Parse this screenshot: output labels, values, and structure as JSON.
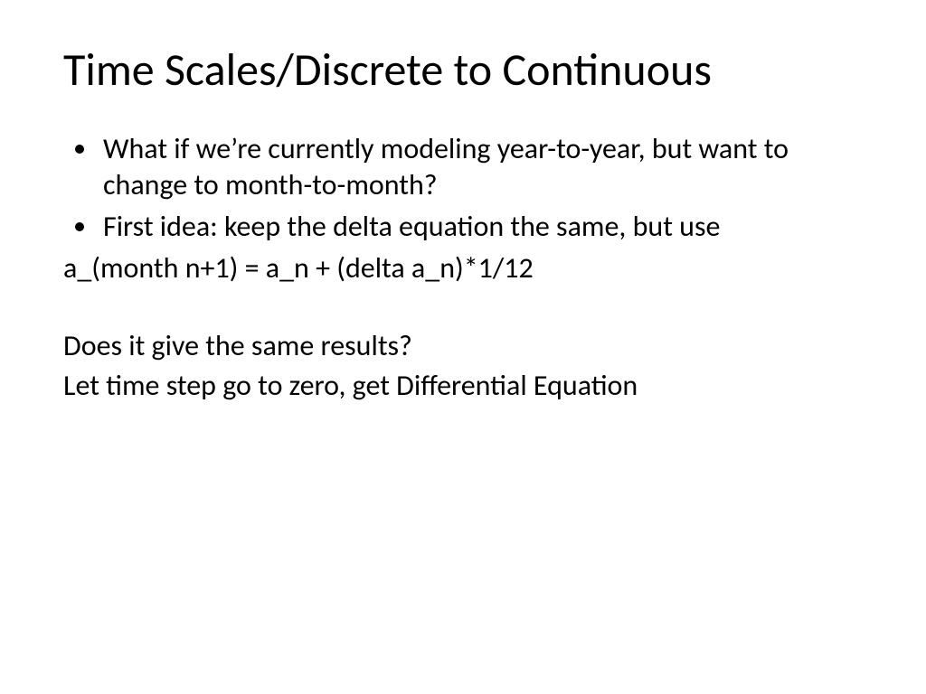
{
  "slide": {
    "title": "Time Scales/Discrete to Continuous",
    "bullets": [
      "What if we’re currently modeling year-to-year, but want to change to month-to-month?",
      "First idea: keep the delta equation the same, but use"
    ],
    "equation": "a_(month n+1) = a_n + (delta a_n)*1/12",
    "question": "Does it give the same results?",
    "conclusion": "Let time step go to zero, get Differential Equation"
  }
}
